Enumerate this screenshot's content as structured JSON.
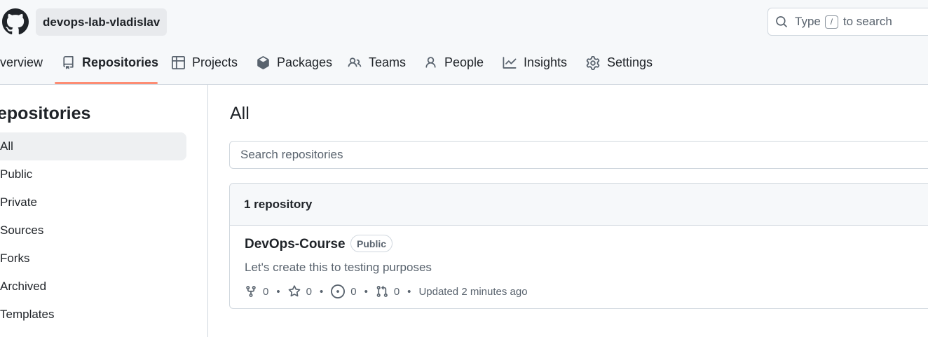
{
  "header": {
    "org_name": "devops-lab-vladislav",
    "search": {
      "label": "Type",
      "key": "/",
      "suffix": "to search"
    }
  },
  "tabs": [
    {
      "label": "Overview",
      "icon": "book-icon",
      "visible_text": "verview"
    },
    {
      "label": "Repositories",
      "icon": "repo-icon",
      "active": true
    },
    {
      "label": "Projects",
      "icon": "table-icon"
    },
    {
      "label": "Packages",
      "icon": "package-icon"
    },
    {
      "label": "Teams",
      "icon": "people-icon"
    },
    {
      "label": "People",
      "icon": "person-icon"
    },
    {
      "label": "Insights",
      "icon": "graph-icon"
    },
    {
      "label": "Settings",
      "icon": "gear-icon"
    }
  ],
  "sidebar": {
    "title": "Repositories",
    "title_visible": "epositories",
    "items": [
      {
        "label": "All",
        "visible": "All",
        "selected": true
      },
      {
        "label": "Public",
        "visible": "Public"
      },
      {
        "label": "Private",
        "visible": "Private"
      },
      {
        "label": "Sources",
        "visible": "Sources"
      },
      {
        "label": "Forks",
        "visible": "Forks"
      },
      {
        "label": "Archived",
        "visible": "Archived"
      },
      {
        "label": "Templates",
        "visible": "Templates"
      }
    ]
  },
  "main": {
    "title": "All",
    "search_placeholder": "Search repositories",
    "count_label": "1 repository",
    "repos": [
      {
        "name": "DevOps-Course",
        "visibility": "Public",
        "description": "Let's create this to testing purposes",
        "forks": "0",
        "stars": "0",
        "issues": "0",
        "pulls": "0",
        "updated": "Updated 2 minutes ago"
      }
    ]
  },
  "colors": {
    "header_bg": "#f6f8fa",
    "active_tab_underline": "#fd8c73",
    "border": "#d0d7de",
    "muted_text": "#59636e"
  }
}
